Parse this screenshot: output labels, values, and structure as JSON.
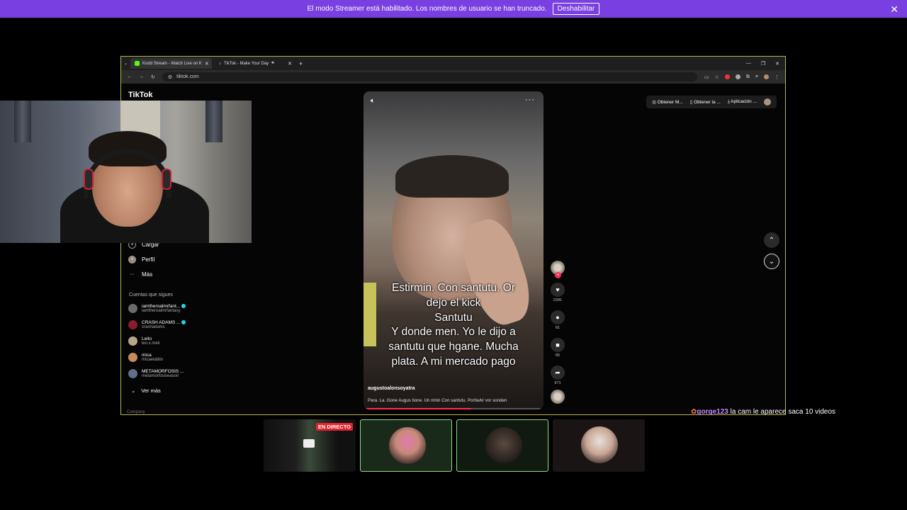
{
  "banner": {
    "text": "El modo Streamer está habilitado. Los nombres de usuario se han truncado.",
    "button": "Deshabilitar"
  },
  "browser": {
    "tabs": [
      {
        "label": "Kodd Stream - Watch Live on K",
        "favicon_color": "#53fc18"
      },
      {
        "label": "TikTok - Make Your Day",
        "favicon_color": "#ffffff"
      }
    ],
    "url": "tiktok.com"
  },
  "tiktok": {
    "logo": "TikTok",
    "sidebar": [
      {
        "label": "Cargar",
        "icon": "upload-icon",
        "glyph": "+"
      },
      {
        "label": "Perfil",
        "icon": "profile-icon",
        "glyph": "•"
      },
      {
        "label": "Más",
        "icon": "more-icon",
        "glyph": "···"
      }
    ],
    "following_title": "Cuentas que sigues",
    "accounts": [
      {
        "name": "iamtheroalmrfant...",
        "handle": "iamtheroalmrfantasy",
        "verified": true,
        "color": "#6b6b6b"
      },
      {
        "name": "CRASH ADAMS ...",
        "handle": "crashadams",
        "verified": true,
        "color": "#8a1c2a"
      },
      {
        "name": "Leito",
        "handle": "leo.x.meli",
        "verified": false,
        "color": "#b7a48f"
      },
      {
        "name": "mica",
        "handle": "micaelabilo",
        "verified": false,
        "color": "#c58a5e"
      },
      {
        "name": "METAMORFOSIS ...",
        "handle": "metamorfosiseason",
        "verified": false,
        "color": "#5f6f8a"
      }
    ],
    "ver_mas": "Ver más",
    "company": "Company",
    "top_actions": [
      "Obtener M...",
      "Obtener la ...",
      "Aplicación ..."
    ],
    "video": {
      "caption": "Estirmin.   Con santutu. Or\ndejo el kick\nSantutu\nY donde men.  Yo le dijo a\nsantutu que hgane. Mucha\nplata.  A mi mercado pago",
      "username": "augustoalonsoyatra",
      "description": "Para. La. Gone Augus tione. Un rimin   Con santutu.  Porfavkr vor sonden",
      "progress": 0.6
    },
    "counts": {
      "likes": "2341",
      "comments": "61",
      "saves": "65",
      "shares": "971"
    }
  },
  "chat": {
    "user": "gorge123",
    "message": "la cam le aparece saca 10 videos"
  },
  "thumbnails": {
    "live_badge": "EN DIRECTO"
  }
}
